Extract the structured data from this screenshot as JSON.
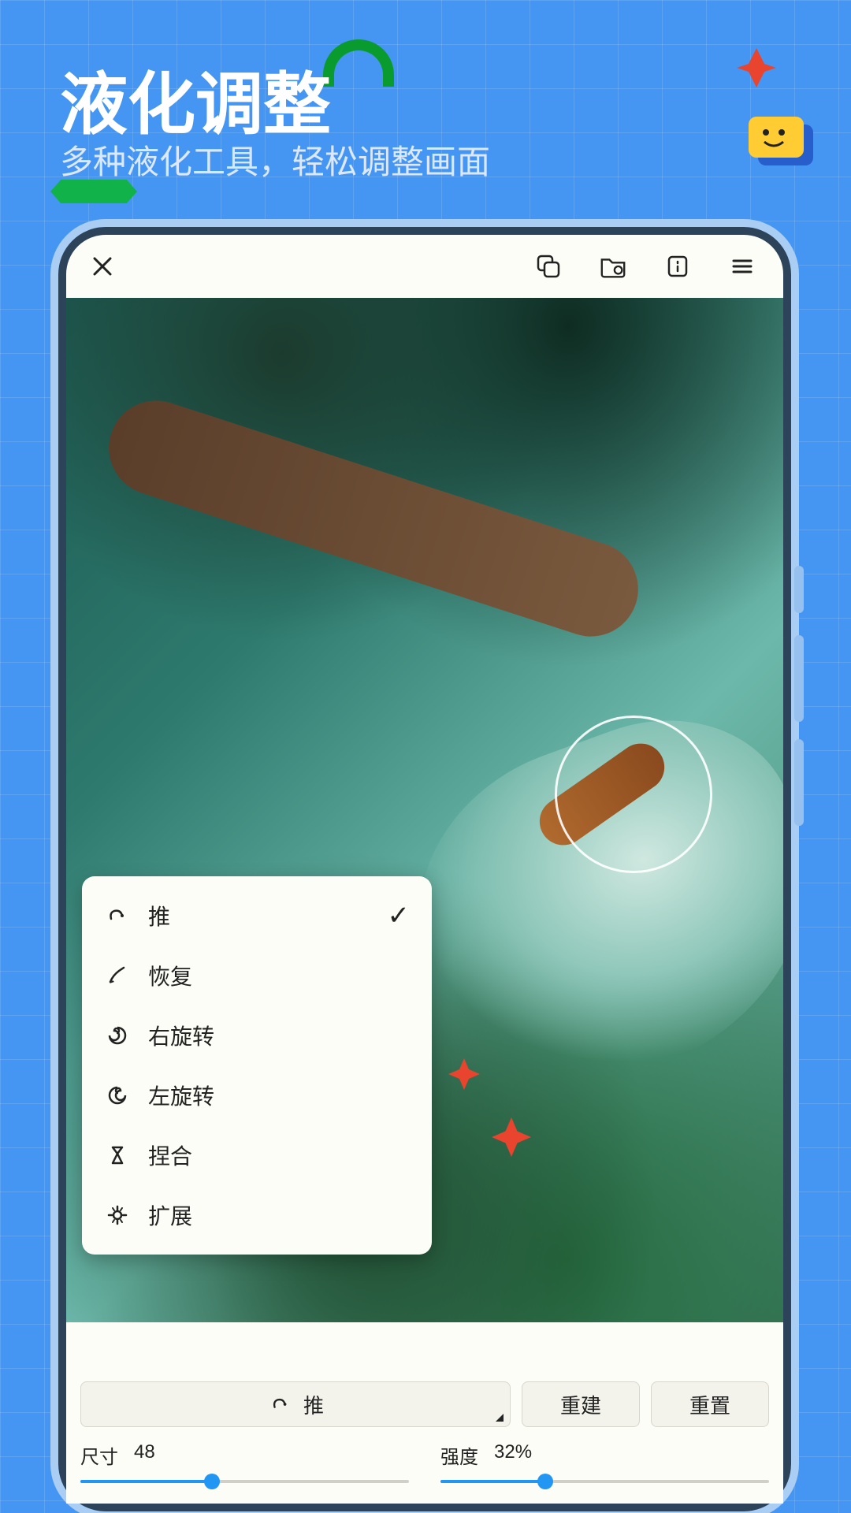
{
  "headline": "液化调整",
  "subline": "多种液化工具，轻松调整画面",
  "appbar": {
    "close": "close"
  },
  "popup": {
    "items": [
      {
        "label": "推",
        "selected": true
      },
      {
        "label": "恢复",
        "selected": false
      },
      {
        "label": "右旋转",
        "selected": false
      },
      {
        "label": "左旋转",
        "selected": false
      },
      {
        "label": "捏合",
        "selected": false
      },
      {
        "label": "扩展",
        "selected": false
      }
    ]
  },
  "controls": {
    "main_button": "推",
    "rebuild": "重建",
    "reset": "重置",
    "size_label": "尺寸",
    "size_value": "48",
    "size_percent": 40,
    "strength_label": "强度",
    "strength_value": "32%",
    "strength_percent": 32
  }
}
